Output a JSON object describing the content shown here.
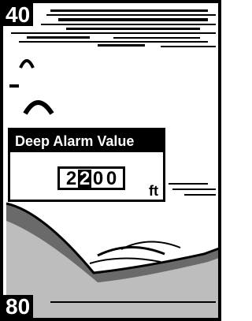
{
  "depth_scale": {
    "top": "40",
    "bottom": "80"
  },
  "dialog": {
    "title": "Deep Alarm Value",
    "digits": [
      "2",
      "2",
      "0",
      "0"
    ],
    "cursor_index": 1,
    "unit": "ft"
  },
  "colors": {
    "ink": "#000000",
    "paper": "#ffffff"
  }
}
